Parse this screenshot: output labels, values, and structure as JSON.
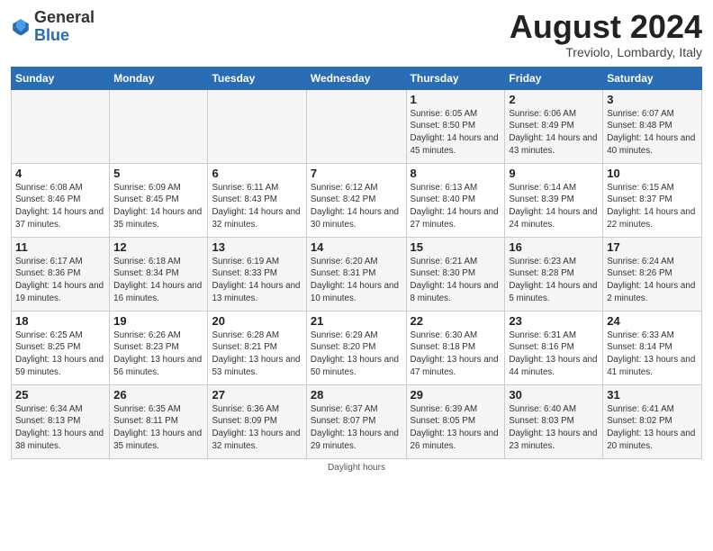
{
  "header": {
    "logo_general": "General",
    "logo_blue": "Blue",
    "month_title": "August 2024",
    "subtitle": "Treviolo, Lombardy, Italy"
  },
  "days_of_week": [
    "Sunday",
    "Monday",
    "Tuesday",
    "Wednesday",
    "Thursday",
    "Friday",
    "Saturday"
  ],
  "weeks": [
    [
      {
        "day": "",
        "info": ""
      },
      {
        "day": "",
        "info": ""
      },
      {
        "day": "",
        "info": ""
      },
      {
        "day": "",
        "info": ""
      },
      {
        "day": "1",
        "info": "Sunrise: 6:05 AM\nSunset: 8:50 PM\nDaylight: 14 hours and 45 minutes."
      },
      {
        "day": "2",
        "info": "Sunrise: 6:06 AM\nSunset: 8:49 PM\nDaylight: 14 hours and 43 minutes."
      },
      {
        "day": "3",
        "info": "Sunrise: 6:07 AM\nSunset: 8:48 PM\nDaylight: 14 hours and 40 minutes."
      }
    ],
    [
      {
        "day": "4",
        "info": "Sunrise: 6:08 AM\nSunset: 8:46 PM\nDaylight: 14 hours and 37 minutes."
      },
      {
        "day": "5",
        "info": "Sunrise: 6:09 AM\nSunset: 8:45 PM\nDaylight: 14 hours and 35 minutes."
      },
      {
        "day": "6",
        "info": "Sunrise: 6:11 AM\nSunset: 8:43 PM\nDaylight: 14 hours and 32 minutes."
      },
      {
        "day": "7",
        "info": "Sunrise: 6:12 AM\nSunset: 8:42 PM\nDaylight: 14 hours and 30 minutes."
      },
      {
        "day": "8",
        "info": "Sunrise: 6:13 AM\nSunset: 8:40 PM\nDaylight: 14 hours and 27 minutes."
      },
      {
        "day": "9",
        "info": "Sunrise: 6:14 AM\nSunset: 8:39 PM\nDaylight: 14 hours and 24 minutes."
      },
      {
        "day": "10",
        "info": "Sunrise: 6:15 AM\nSunset: 8:37 PM\nDaylight: 14 hours and 22 minutes."
      }
    ],
    [
      {
        "day": "11",
        "info": "Sunrise: 6:17 AM\nSunset: 8:36 PM\nDaylight: 14 hours and 19 minutes."
      },
      {
        "day": "12",
        "info": "Sunrise: 6:18 AM\nSunset: 8:34 PM\nDaylight: 14 hours and 16 minutes."
      },
      {
        "day": "13",
        "info": "Sunrise: 6:19 AM\nSunset: 8:33 PM\nDaylight: 14 hours and 13 minutes."
      },
      {
        "day": "14",
        "info": "Sunrise: 6:20 AM\nSunset: 8:31 PM\nDaylight: 14 hours and 10 minutes."
      },
      {
        "day": "15",
        "info": "Sunrise: 6:21 AM\nSunset: 8:30 PM\nDaylight: 14 hours and 8 minutes."
      },
      {
        "day": "16",
        "info": "Sunrise: 6:23 AM\nSunset: 8:28 PM\nDaylight: 14 hours and 5 minutes."
      },
      {
        "day": "17",
        "info": "Sunrise: 6:24 AM\nSunset: 8:26 PM\nDaylight: 14 hours and 2 minutes."
      }
    ],
    [
      {
        "day": "18",
        "info": "Sunrise: 6:25 AM\nSunset: 8:25 PM\nDaylight: 13 hours and 59 minutes."
      },
      {
        "day": "19",
        "info": "Sunrise: 6:26 AM\nSunset: 8:23 PM\nDaylight: 13 hours and 56 minutes."
      },
      {
        "day": "20",
        "info": "Sunrise: 6:28 AM\nSunset: 8:21 PM\nDaylight: 13 hours and 53 minutes."
      },
      {
        "day": "21",
        "info": "Sunrise: 6:29 AM\nSunset: 8:20 PM\nDaylight: 13 hours and 50 minutes."
      },
      {
        "day": "22",
        "info": "Sunrise: 6:30 AM\nSunset: 8:18 PM\nDaylight: 13 hours and 47 minutes."
      },
      {
        "day": "23",
        "info": "Sunrise: 6:31 AM\nSunset: 8:16 PM\nDaylight: 13 hours and 44 minutes."
      },
      {
        "day": "24",
        "info": "Sunrise: 6:33 AM\nSunset: 8:14 PM\nDaylight: 13 hours and 41 minutes."
      }
    ],
    [
      {
        "day": "25",
        "info": "Sunrise: 6:34 AM\nSunset: 8:13 PM\nDaylight: 13 hours and 38 minutes."
      },
      {
        "day": "26",
        "info": "Sunrise: 6:35 AM\nSunset: 8:11 PM\nDaylight: 13 hours and 35 minutes."
      },
      {
        "day": "27",
        "info": "Sunrise: 6:36 AM\nSunset: 8:09 PM\nDaylight: 13 hours and 32 minutes."
      },
      {
        "day": "28",
        "info": "Sunrise: 6:37 AM\nSunset: 8:07 PM\nDaylight: 13 hours and 29 minutes."
      },
      {
        "day": "29",
        "info": "Sunrise: 6:39 AM\nSunset: 8:05 PM\nDaylight: 13 hours and 26 minutes."
      },
      {
        "day": "30",
        "info": "Sunrise: 6:40 AM\nSunset: 8:03 PM\nDaylight: 13 hours and 23 minutes."
      },
      {
        "day": "31",
        "info": "Sunrise: 6:41 AM\nSunset: 8:02 PM\nDaylight: 13 hours and 20 minutes."
      }
    ]
  ],
  "footer": "Daylight hours"
}
